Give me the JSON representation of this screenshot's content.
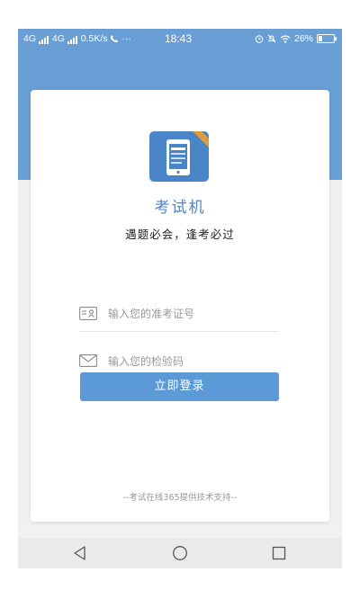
{
  "status_bar": {
    "left_text": "4G",
    "left_text2": "4G",
    "speed": "0.5K/s",
    "extra": "···",
    "time": "18:43",
    "battery": "26%",
    "battery_level": 0.26
  },
  "app": {
    "name": "考试机",
    "slogan": "遇题必会，逢考必过",
    "logo_badge_color": "#e39a3b",
    "logo_bg": "#4a86c7"
  },
  "form": {
    "exam_id": {
      "placeholder": "输入您的准考证号",
      "value": "",
      "icon": "id-card-icon"
    },
    "code": {
      "placeholder": "输入您的检验码",
      "value": "",
      "icon": "mail-icon"
    },
    "login_label": "立即登录"
  },
  "footer": "--考试在线365提供技术支持--",
  "nav": {
    "back": "back-icon",
    "home": "home-icon",
    "recents": "recents-icon"
  },
  "colors": {
    "accent": "#5b9ad6",
    "header_bg": "#6a9fd6"
  }
}
